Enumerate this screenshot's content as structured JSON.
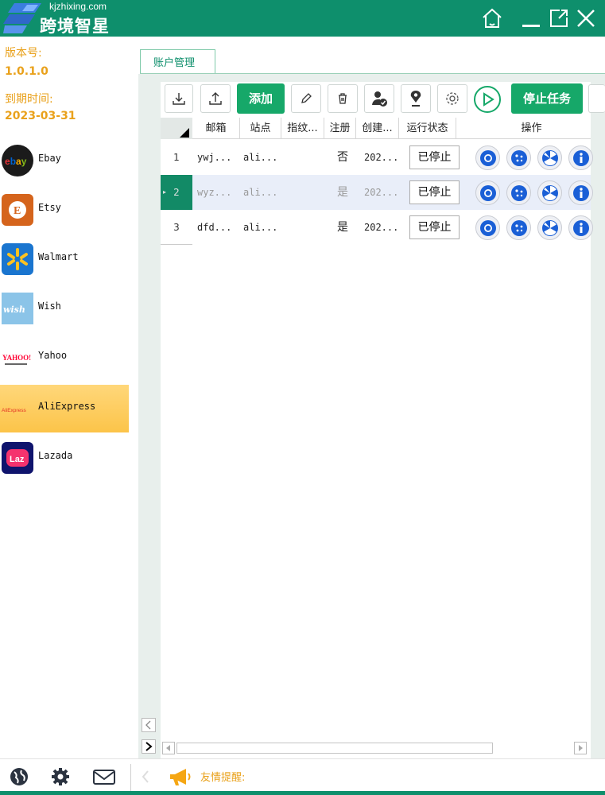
{
  "app": {
    "domain": "kjzhixing.com",
    "name": "跨境智星",
    "brand_color": "#0e8f6c",
    "accent_color": "#16a869",
    "warning_color": "#e9a11b"
  },
  "window_controls": {
    "home": "home-icon",
    "minimize": "minimize-icon",
    "popout": "popout-icon",
    "close": "close-icon"
  },
  "sidebar": {
    "version_label": "版本号:",
    "version_value": "1.0.1.0",
    "expiry_label": "到期时间:",
    "expiry_value": "2023-03-31",
    "platforms": [
      {
        "label": "Ebay",
        "icon": "ebay-icon",
        "active": false
      },
      {
        "label": "Etsy",
        "icon": "etsy-icon",
        "active": false
      },
      {
        "label": "Walmart",
        "icon": "walmart-icon",
        "active": false
      },
      {
        "label": "Wish",
        "icon": "wish-icon",
        "icon_text": "wish",
        "active": false
      },
      {
        "label": "Yahoo",
        "icon": "yahoo-icon",
        "icon_text": "YAHOO!",
        "active": false
      },
      {
        "label": "AliExpress",
        "icon": "aliexpress-icon",
        "icon_text": "AliExpress",
        "active": true
      },
      {
        "label": "Lazada",
        "icon": "lazada-icon",
        "icon_text": "Laz",
        "active": false
      }
    ]
  },
  "tabs": [
    {
      "label": "账户管理",
      "active": true
    }
  ],
  "toolbar": {
    "import": "import-icon",
    "export": "export-icon",
    "add_label": "添加",
    "edit": "pencil-icon",
    "delete": "trash-icon",
    "user_check": "user-check-icon",
    "location": "location-pin-icon",
    "settings": "gear-icon",
    "start": "play-icon",
    "stop_label": "停止任务"
  },
  "table": {
    "columns": [
      "邮箱",
      "站点",
      "指纹...",
      "注册",
      "创建...",
      "运行状态",
      "操作"
    ],
    "rows": [
      {
        "index": "1",
        "email": "ywj...",
        "site": "ali...",
        "fingerprint": "",
        "registered": "否",
        "created": "202...",
        "status": "已停止",
        "selected": false
      },
      {
        "index": "2",
        "email": "wyz...",
        "site": "ali...",
        "fingerprint": "",
        "registered": "是",
        "created": "202...",
        "status": "已停止",
        "selected": true
      },
      {
        "index": "3",
        "email": "dfd...",
        "site": "ali...",
        "fingerprint": "",
        "registered": "是",
        "created": "202...",
        "status": "已停止",
        "selected": false
      }
    ],
    "row_actions": [
      "chrome-icon",
      "cookie-icon",
      "proxy-fan-icon",
      "info-icon"
    ]
  },
  "bottom_bar": {
    "globe": "globe-icon",
    "settings": "gear-icon",
    "mail": "mail-icon",
    "notice": "megaphone-icon",
    "notice_label": "友情提醒:"
  }
}
